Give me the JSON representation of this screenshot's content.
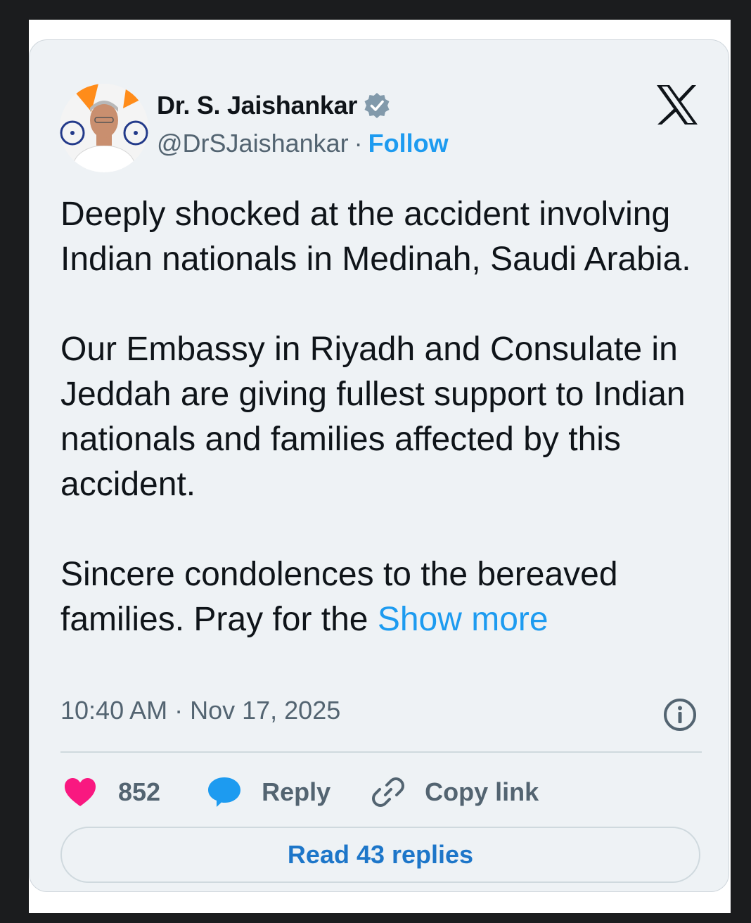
{
  "author": {
    "name": "Dr. S. Jaishankar",
    "handle": "@DrSJaishankar",
    "separator": "·",
    "follow_label": "Follow",
    "verified": true
  },
  "tweet": {
    "text": "Deeply shocked at the accident involving Indian nationals in Medinah, Saudi Arabia.\n\nOur Embassy in Riyadh and Consulate in Jeddah are giving fullest support to Indian nationals and families affected by this accident.\n\nSincere condolences to the bereaved families. Pray for the ",
    "show_more_label": "Show more",
    "timestamp": "10:40 AM · Nov 17, 2025"
  },
  "actions": {
    "like_count": "852",
    "reply_label": "Reply",
    "copy_link_label": "Copy link",
    "read_replies_label": "Read 43 replies"
  },
  "icons": {
    "like": "heart-icon",
    "reply": "speech-bubble-icon",
    "copy": "link-icon",
    "info": "info-icon",
    "brand": "x-logo-icon",
    "verified": "verified-badge-icon"
  },
  "colors": {
    "accent": "#1d9bf0",
    "like": "#f91880",
    "card_bg": "#eef2f5",
    "text": "#0f1419",
    "muted": "#536471"
  }
}
